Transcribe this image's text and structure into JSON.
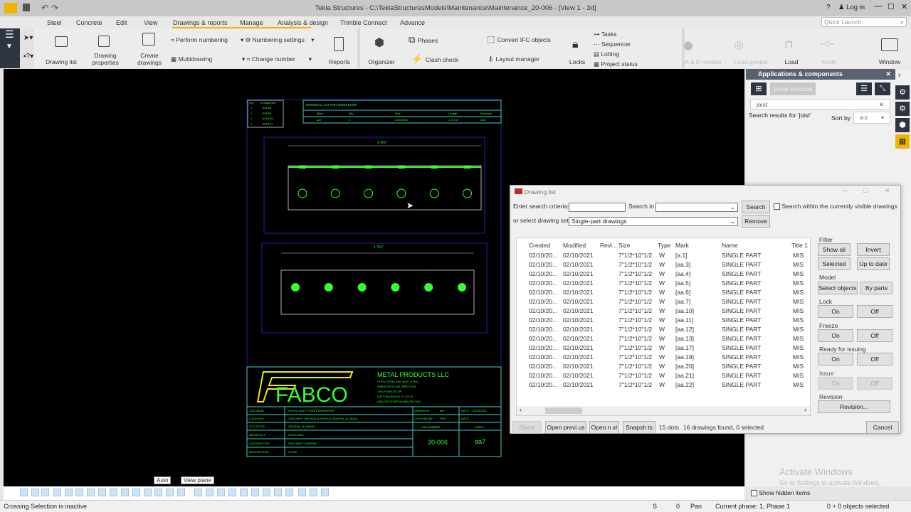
{
  "title": "Tekla Structures - C:\\TeklaStructuresModels\\Maintenance\\Maintenance_20-006  - [View 1 - 3d]",
  "login": "Log in",
  "help": "?",
  "quick_launch": "Quick Launch",
  "tabs": [
    "Steel",
    "Concrete",
    "Edit",
    "View",
    "Drawings & reports",
    "Manage",
    "Analysis & design",
    "Trimble Connect",
    "Advance"
  ],
  "ribbon": {
    "drawing_list": "Drawing list",
    "drawing_properties_1": "Drawing",
    "drawing_properties_2": "properties",
    "create_drawings_1": "Create",
    "create_drawings_2": "drawings",
    "perform_numbering": "Perform numbering",
    "multidrawing": "Multidrawing",
    "numbering_settings": "Numbering settings",
    "change_number": "Change number",
    "reports": "Reports",
    "organizer": "Organizer",
    "phases": "Phases",
    "clash_check": "Clash check",
    "convert_ifc": "Convert IFC objects",
    "layout_manager": "Layout manager",
    "locks": "Locks",
    "tasks": "Tasks",
    "sequencer": "Sequencer",
    "lotting": "Lotting",
    "project_status": "Project status",
    "ad_models": "A & D models",
    "load_groups": "Load groups",
    "load": "Load",
    "node": "Node",
    "window": "Window"
  },
  "apps": {
    "title": "Applications & components",
    "show_selected": "Show selected",
    "search_value": "joist",
    "results": "Search results for 'joist'",
    "sort_by": "Sort by",
    "sort_value": "a-z",
    "show_hidden": "Show hidden items",
    "activate_1": "Activate Windows",
    "activate_2": "Go to Settings to activate Windows."
  },
  "dialog": {
    "title": "Drawing list",
    "criteria_label": "Enter search criteria:",
    "search_in_label": "Search in",
    "search_btn": "Search",
    "visible_only": "Search within the currently visible drawings",
    "set_label": "or select drawing set",
    "set_value": "Single-part drawings",
    "remove_btn": "Remove",
    "columns": [
      "Created",
      "Modified",
      "Revi...",
      "Size",
      "Type",
      "Mark",
      "Name",
      "Title 1"
    ],
    "rows": [
      [
        "02/10/20...",
        "02/10/2021",
        "",
        "7\"1/2*10\"1/2",
        "W",
        "[a.1]",
        "SINGLE PART",
        "MIS"
      ],
      [
        "02/10/20...",
        "02/10/2021",
        "",
        "7\"1/2*10\"1/2",
        "W",
        "[aa.3]",
        "SINGLE PART",
        "MIS"
      ],
      [
        "02/10/20...",
        "02/10/2021",
        "",
        "7\"1/2*10\"1/2",
        "W",
        "[aa.4]",
        "SINGLE PART",
        "MIS"
      ],
      [
        "02/10/20...",
        "02/10/2021",
        "",
        "7\"1/2*10\"1/2",
        "W",
        "[aa.5]",
        "SINGLE PART",
        "MIS"
      ],
      [
        "02/10/20...",
        "02/10/2021",
        "",
        "7\"1/2*10\"1/2",
        "W",
        "[aa.6]",
        "SINGLE PART",
        "MIS"
      ],
      [
        "02/10/20...",
        "02/10/2021",
        "",
        "7\"1/2*10\"1/2",
        "W",
        "[aa.7]",
        "SINGLE PART",
        "MIS"
      ],
      [
        "02/10/20...",
        "02/10/2021",
        "",
        "7\"1/2*10\"1/2",
        "W",
        "[aa.10]",
        "SINGLE PART",
        "MIS"
      ],
      [
        "02/10/20...",
        "02/10/2021",
        "",
        "7\"1/2*10\"1/2",
        "W",
        "[aa.11]",
        "SINGLE PART",
        "MIS"
      ],
      [
        "02/10/20...",
        "02/10/2021",
        "",
        "7\"1/2*10\"1/2",
        "W",
        "[aa.12]",
        "SINGLE PART",
        "MIS"
      ],
      [
        "02/10/20...",
        "02/10/2021",
        "",
        "7\"1/2*10\"1/2",
        "W",
        "[aa.13]",
        "SINGLE PART",
        "MIS"
      ],
      [
        "02/10/20...",
        "02/10/2021",
        "",
        "7\"1/2*10\"1/2",
        "W",
        "[aa.17]",
        "SINGLE PART",
        "MIS"
      ],
      [
        "02/10/20...",
        "02/10/2021",
        "",
        "7\"1/2*10\"1/2",
        "W",
        "[aa.19]",
        "SINGLE PART",
        "MIS"
      ],
      [
        "02/10/20...",
        "02/10/2021",
        "",
        "7\"1/2*10\"1/2",
        "W",
        "[aa.20]",
        "SINGLE PART",
        "MIS"
      ],
      [
        "02/10/20...",
        "02/10/2021",
        "",
        "7\"1/2*10\"1/2",
        "W",
        "[aa.21]",
        "SINGLE PART",
        "MIS"
      ],
      [
        "02/10/20...",
        "02/10/2021",
        "",
        "7\"1/2*10\"1/2",
        "W",
        "[aa.22]",
        "SINGLE PART",
        "MIS"
      ]
    ],
    "filter": {
      "label": "Filter",
      "show_all": "Show all",
      "invert": "Invert",
      "selected": "Selected",
      "up_to_date": "Up to date"
    },
    "model": {
      "label": "Model",
      "select_objects": "Select objects",
      "by_parts": "By parts"
    },
    "lock": {
      "label": "Lock",
      "on": "On",
      "off": "Off"
    },
    "freeze": {
      "label": "Freeze",
      "on": "On",
      "off": "Off"
    },
    "ready": {
      "label": "Ready for issuing",
      "on": "On",
      "off": "Off"
    },
    "issue": {
      "label": "Issue",
      "on": "On",
      "off": "Off"
    },
    "revision": {
      "label": "Revision",
      "button": "Revision..."
    },
    "open": "Open",
    "open_previous": "Open previ us",
    "open_next": "Open n xt",
    "snapshots": "Snapsh ts",
    "dots": "15 dots",
    "found": "16 drawings found, 0 selected",
    "cancel": "Cancel"
  },
  "drawing": {
    "logo": "FABCO",
    "company": "METAL PRODUCTS LLC",
    "addr": [
      "STRUCTURAL AND MISC. STEEL",
      "FABRICATION AND ERECTION",
      "1490 FRANCES DR.",
      "DAYTONA BEACH, FL 32124",
      "(386) 252-3730/FAX (386) 258-3402"
    ],
    "fields": [
      [
        "JOB NAME:",
        "SYSCO GULF COAST EXPANSION"
      ],
      [
        "LOCATION:",
        "2000 WEST MAGNOLIA AVENUE GENEVA, AL 36340"
      ],
      [
        "CITY,STATE:",
        "GENEVA, ALABAMA"
      ],
      [
        "ARCHITECT:",
        "LEO A DALY"
      ],
      [
        "CONTRACTOR:",
        "WILLIAMS COMPANY"
      ],
      [
        "DESCRIPTION:",
        "PLATE"
      ]
    ],
    "drawn_by": "DRAWN BY:",
    "drawn_val": "MS",
    "checked_by": "CHECKED BY:",
    "checked_val": "END",
    "date": "DATE:",
    "date_val": "02/10/2021",
    "date2": "DATE:",
    "job_number": "JOB NUMBER",
    "sheet": "SHEET",
    "job": "20-006",
    "sheet_val": "aa7",
    "material_title": "MATERIAL LIST FOR WORKSHOP",
    "mat_cols": [
      "Mark",
      "Qty.",
      "Size",
      "Length",
      "Remarks"
    ],
    "mat_row": [
      "aa7",
      "4",
      "L4X4X3/8",
      "1'-5 1/2\"",
      "A36"
    ],
    "asm_cols": [
      "Qty.",
      "In Assembly"
    ],
    "asm_rows": [
      [
        "1",
        "10/18/8"
      ],
      [
        "1",
        "10/18/9"
      ],
      [
        "1",
        "10/18/16"
      ],
      [
        "1",
        "10/18/17"
      ]
    ],
    "dim_top": "1'-5½\"",
    "dim_bottom": "1'-5½\""
  },
  "canvas_labels": {
    "auto": "Auto",
    "view_plane": "View plane"
  },
  "status": {
    "message": "Crossing Selection is inactive",
    "s": "S",
    "zero": "0",
    "pan": "Pan",
    "phase": "Current phase: 1, Phase 1",
    "selected": "0 + 0 objects selected"
  }
}
